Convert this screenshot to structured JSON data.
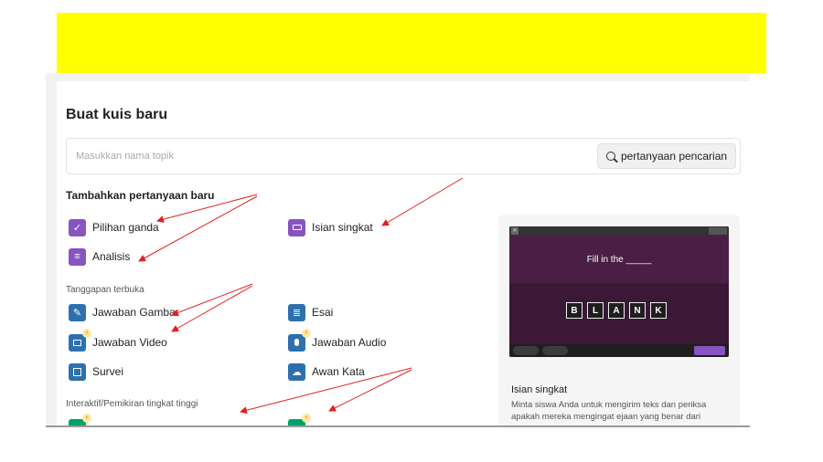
{
  "page": {
    "title": "Buat kuis baru",
    "search": {
      "placeholder": "Masukkan nama topik",
      "button_label": "pertanyaan pencarian"
    }
  },
  "sections": {
    "add_new": {
      "heading": "Tambahkan pertanyaan baru",
      "items": [
        {
          "label": "Pilihan ganda",
          "icon": "checkbox-icon",
          "color": "#8854c0"
        },
        {
          "label": "Isian singkat",
          "icon": "textbox-icon",
          "color": "#8854c0"
        },
        {
          "label": "Analisis",
          "icon": "list-icon",
          "color": "#8854c0"
        }
      ]
    },
    "open_ended": {
      "heading": "Tanggapan terbuka",
      "items": [
        {
          "label": "Jawaban Gambar",
          "icon": "draw-icon",
          "color": "#2d70ae"
        },
        {
          "label": "Esai",
          "icon": "paragraph-icon",
          "color": "#2d70ae"
        },
        {
          "label": "Jawaban Video",
          "icon": "video-icon",
          "color": "#2d70ae",
          "premium": true
        },
        {
          "label": "Jawaban Audio",
          "icon": "microphone-icon",
          "color": "#2d70ae",
          "premium": true
        },
        {
          "label": "Survei",
          "icon": "poll-icon",
          "color": "#2d70ae"
        },
        {
          "label": "Awan Kata",
          "icon": "cloud-icon",
          "color": "#2d70ae"
        }
      ]
    },
    "interactive": {
      "heading": "Interaktif/Pemikiran tingkat tinggi"
    }
  },
  "preview": {
    "question_text": "Fill in the _____",
    "letters": [
      "B",
      "L",
      "A",
      "N",
      "K"
    ],
    "title": "Isian singkat",
    "description": "Minta siswa Anda untuk mengirim teks dan periksa apakah mereka mengingat ejaan yang benar dari"
  },
  "colors": {
    "banner": "#ffff00",
    "accent_purple": "#8854c0",
    "accent_blue": "#2d70ae",
    "accent_green": "#00a06a",
    "annotation_arrow": "#e02020"
  }
}
